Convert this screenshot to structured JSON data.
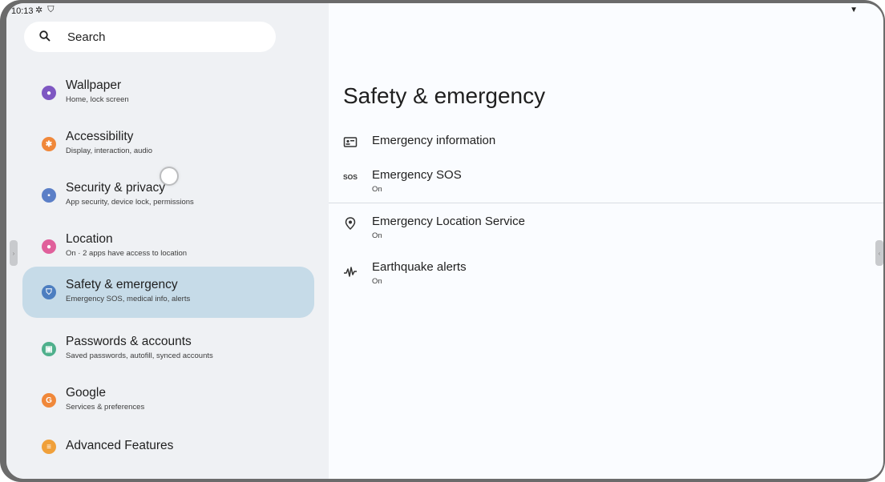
{
  "status_bar": {
    "time": "10:13",
    "icons": [
      "gear-icon",
      "shield-icon"
    ],
    "right_icon": "wifi-icon"
  },
  "search": {
    "label": "Search"
  },
  "sidebar": {
    "items": [
      {
        "title": "Wallpaper",
        "subtitle": "Home, lock screen",
        "icon": "palette-icon",
        "color": "#7e57c2"
      },
      {
        "title": "Accessibility",
        "subtitle": "Display, interaction, audio",
        "icon": "accessibility-icon",
        "color": "#f0883a"
      },
      {
        "title": "Security & privacy",
        "subtitle": "App security, device lock, permissions",
        "icon": "lock-icon",
        "color": "#5b7fc7"
      },
      {
        "title": "Location",
        "subtitle": "On · 2 apps have access to location",
        "icon": "location-pin-icon",
        "color": "#e0609b"
      },
      {
        "title": "Safety & emergency",
        "subtitle": "Emergency SOS, medical info, alerts",
        "icon": "safety-shield-icon",
        "color": "#4d7ec0",
        "selected": true
      },
      {
        "title": "Passwords & accounts",
        "subtitle": "Saved passwords, autofill, synced accounts",
        "icon": "account-icon",
        "color": "#4fb08c"
      },
      {
        "title": "Google",
        "subtitle": "Services & preferences",
        "icon": "google-icon",
        "color": "#f0883a"
      },
      {
        "title": "Advanced Features",
        "subtitle": "",
        "icon": "advanced-features-icon",
        "color": "#f0a03a"
      }
    ]
  },
  "main": {
    "title": "Safety & emergency",
    "rows": [
      {
        "title": "Emergency information",
        "subtitle": "",
        "icon": "id-card-icon",
        "icon_text": ""
      },
      {
        "title": "Emergency SOS",
        "subtitle": "On",
        "icon": "sos-icon",
        "icon_text": "SOS"
      },
      {
        "title": "Emergency Location Service",
        "subtitle": "On",
        "icon": "location-target-icon",
        "icon_text": ""
      },
      {
        "title": "Earthquake alerts",
        "subtitle": "On",
        "icon": "earthquake-wave-icon",
        "icon_text": ""
      }
    ]
  }
}
